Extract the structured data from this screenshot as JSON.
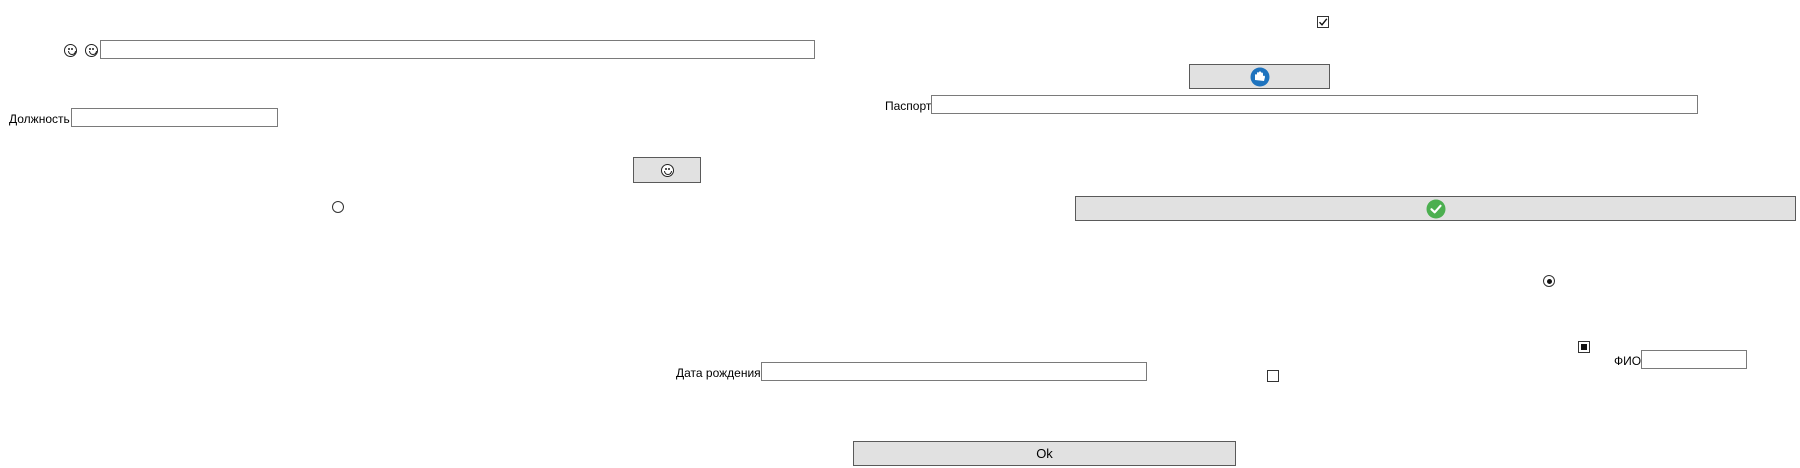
{
  "labels": {
    "position": "Должность",
    "passport": "Паспорт",
    "birth_date": "Дата рождения",
    "full_name": "ФИО"
  },
  "fields": {
    "top_text": "",
    "position": "",
    "passport": "",
    "birth_date": "",
    "full_name": ""
  },
  "buttons": {
    "ok": "Ok"
  },
  "checkboxes": {
    "top_checkbox": "checked",
    "indeterminate_checkbox": "indeterminate",
    "bottom_checkbox": "unchecked"
  },
  "radios": {
    "left_radio": "unselected",
    "right_radio": "selected"
  },
  "icons": {
    "emoji_1": "grinning-face-icon",
    "emoji_2": "smiling-face-icon",
    "emoji_button": "grinning-face-icon",
    "blue_button": "blue-cloud-hand-icon",
    "green_button": "green-checkmark-icon"
  },
  "colors": {
    "button_bg": "#e1e1e1",
    "check_green": "#4caf50",
    "icon_blue": "#1e73be"
  }
}
